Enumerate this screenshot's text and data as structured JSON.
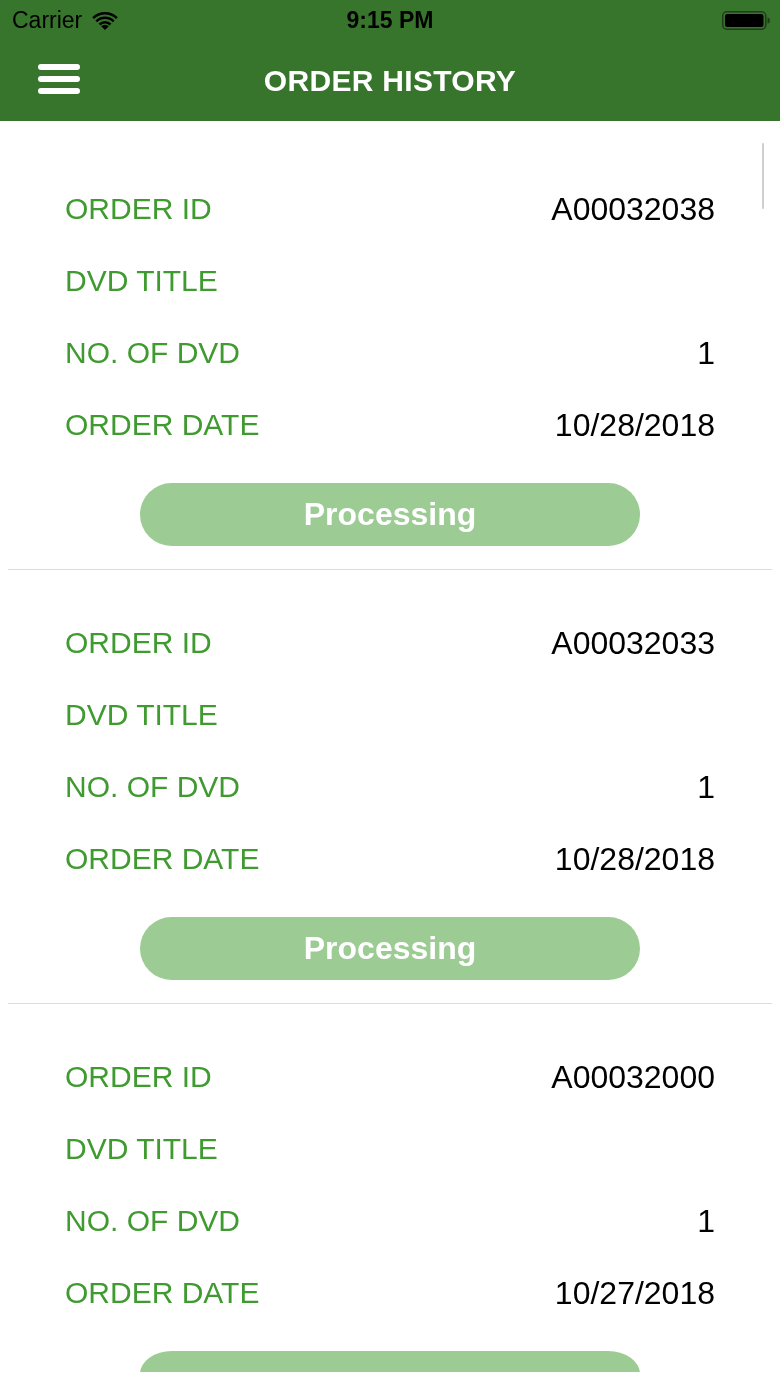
{
  "status_bar": {
    "carrier": "Carrier",
    "time": "9:15 PM"
  },
  "header": {
    "title": "ORDER HISTORY"
  },
  "orders": [
    {
      "fields": [
        {
          "label": "ORDER ID",
          "value": "A00032038"
        },
        {
          "label": "DVD TITLE"
        },
        {
          "label": "NO. OF DVD",
          "value": "1"
        },
        {
          "label": "ORDER DATE",
          "value": "10/28/2018"
        }
      ],
      "status": "Processing"
    },
    {
      "fields": [
        {
          "label": "ORDER ID",
          "value": "A00032033"
        },
        {
          "label": "DVD TITLE"
        },
        {
          "label": "NO. OF DVD",
          "value": "1"
        },
        {
          "label": "ORDER DATE",
          "value": "10/28/2018"
        }
      ],
      "status": "Processing"
    },
    {
      "fields": [
        {
          "label": "ORDER ID",
          "value": "A00032000"
        },
        {
          "label": "DVD TITLE"
        },
        {
          "label": "NO. OF DVD",
          "value": "1"
        },
        {
          "label": "ORDER DATE",
          "value": "10/27/2018"
        }
      ]
    }
  ]
}
